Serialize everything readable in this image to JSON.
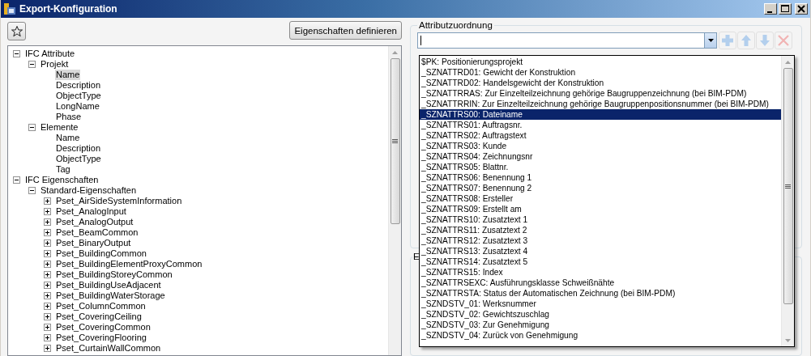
{
  "window": {
    "title": "Export-Konfiguration"
  },
  "define_button": "Eigenschaften definieren",
  "tree": [
    {
      "label": "IFC Attribute",
      "expanded": true,
      "selected": false,
      "children": [
        {
          "label": "Projekt",
          "expanded": true,
          "selected": false,
          "children": [
            {
              "label": "Name",
              "selected": true
            },
            {
              "label": "Description",
              "selected": false
            },
            {
              "label": "ObjectType",
              "selected": false
            },
            {
              "label": "LongName",
              "selected": false
            },
            {
              "label": "Phase",
              "selected": false
            }
          ]
        },
        {
          "label": "Elemente",
          "expanded": true,
          "selected": false,
          "children": [
            {
              "label": "Name",
              "selected": false
            },
            {
              "label": "Description",
              "selected": false
            },
            {
              "label": "ObjectType",
              "selected": false
            },
            {
              "label": "Tag",
              "selected": false
            }
          ]
        }
      ]
    },
    {
      "label": "IFC Eigenschaften",
      "expanded": true,
      "selected": false,
      "children": [
        {
          "label": "Standard-Eigenschaften",
          "expanded": true,
          "selected": false,
          "children": [
            {
              "label": "Pset_AirSideSystemInformation",
              "expanded": false,
              "selected": false
            },
            {
              "label": "Pset_AnalogInput",
              "expanded": false,
              "selected": false
            },
            {
              "label": "Pset_AnalogOutput",
              "expanded": false,
              "selected": false
            },
            {
              "label": "Pset_BeamCommon",
              "expanded": false,
              "selected": false
            },
            {
              "label": "Pset_BinaryOutput",
              "expanded": false,
              "selected": false
            },
            {
              "label": "Pset_BuildingCommon",
              "expanded": false,
              "selected": false
            },
            {
              "label": "Pset_BuildingElementProxyCommon",
              "expanded": false,
              "selected": false
            },
            {
              "label": "Pset_BuildingStoreyCommon",
              "expanded": false,
              "selected": false
            },
            {
              "label": "Pset_BuildingUseAdjacent",
              "expanded": false,
              "selected": false
            },
            {
              "label": "Pset_BuildingWaterStorage",
              "expanded": false,
              "selected": false
            },
            {
              "label": "Pset_ColumnCommon",
              "expanded": false,
              "selected": false
            },
            {
              "label": "Pset_CoveringCeiling",
              "expanded": false,
              "selected": false
            },
            {
              "label": "Pset_CoveringCommon",
              "expanded": false,
              "selected": false
            },
            {
              "label": "Pset_CoveringFlooring",
              "expanded": false,
              "selected": false
            },
            {
              "label": "Pset_CurtainWallCommon",
              "expanded": false,
              "selected": false
            }
          ]
        }
      ]
    }
  ],
  "attribute_group": {
    "title": "Attributzuordnung",
    "tool_buttons": [
      {
        "kind": "add",
        "disabled": true
      },
      {
        "kind": "up",
        "disabled": true
      },
      {
        "kind": "down",
        "disabled": true
      },
      {
        "kind": "delete",
        "disabled": true
      }
    ],
    "dropdown_items": [
      {
        "label": "$PK: Positionierungsprojekt",
        "selected": false
      },
      {
        "label": "_SZNATTRD01: Gewicht der Konstruktion",
        "selected": false
      },
      {
        "label": "_SZNATTRD02: Handelsgewicht der Konstruktion",
        "selected": false
      },
      {
        "label": "_SZNATTRRAS: Zur Einzelteilzeichnung gehörige Baugruppenzeichnung (bei BIM-PDM)",
        "selected": false
      },
      {
        "label": "_SZNATTRRIN: Zur Einzelteilzeichnung gehörige Baugruppenpositionsnummer (bei BIM-PDM)",
        "selected": false
      },
      {
        "label": "_SZNATTRS00: Dateiname",
        "selected": true
      },
      {
        "label": "_SZNATTRS01: Auftragsnr.",
        "selected": false
      },
      {
        "label": "_SZNATTRS02: Auftragstext",
        "selected": false
      },
      {
        "label": "_SZNATTRS03: Kunde",
        "selected": false
      },
      {
        "label": "_SZNATTRS04: Zeichnungsnr",
        "selected": false
      },
      {
        "label": "_SZNATTRS05: Blattnr.",
        "selected": false
      },
      {
        "label": "_SZNATTRS06: Benennung 1",
        "selected": false
      },
      {
        "label": "_SZNATTRS07: Benennung 2",
        "selected": false
      },
      {
        "label": "_SZNATTRS08: Ersteller",
        "selected": false
      },
      {
        "label": "_SZNATTRS09: Erstellt am",
        "selected": false
      },
      {
        "label": "_SZNATTRS10: Zusatztext 1",
        "selected": false
      },
      {
        "label": "_SZNATTRS11: Zusatztext 2",
        "selected": false
      },
      {
        "label": "_SZNATTRS12: Zusatztext 3",
        "selected": false
      },
      {
        "label": "_SZNATTRS13: Zusatztext 4",
        "selected": false
      },
      {
        "label": "_SZNATTRS14: Zusatztext 5",
        "selected": false
      },
      {
        "label": "_SZNATTRS15: Index",
        "selected": false
      },
      {
        "label": "_SZNATTRSEXC: Ausführungsklasse Schweißnähte",
        "selected": false
      },
      {
        "label": "_SZNATTRSTA: Status der Automatischen Zeichnung (bei BIM-PDM)",
        "selected": false
      },
      {
        "label": "_SZNDSTV_01: Werksnummer",
        "selected": false
      },
      {
        "label": "_SZNDSTV_02: Gewichtszuschlag",
        "selected": false
      },
      {
        "label": "_SZNDSTV_03: Zur Genehmigung",
        "selected": false
      },
      {
        "label": "_SZNDSTV_04: Zurück von Genehmigung",
        "selected": false
      }
    ]
  },
  "second_group": {
    "title": "E"
  }
}
